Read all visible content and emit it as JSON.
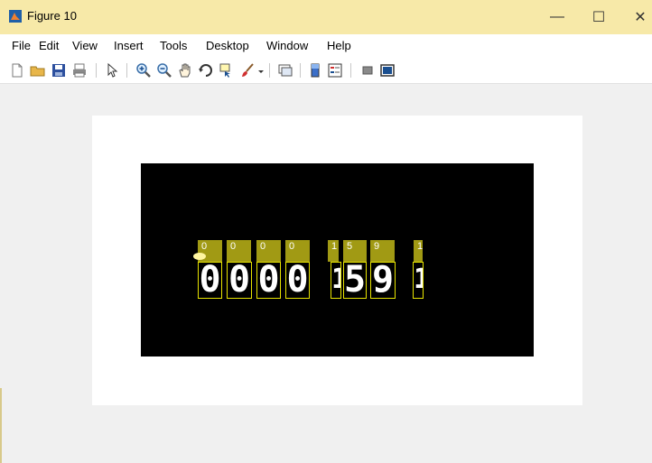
{
  "window": {
    "title": "Figure 10",
    "minimize_symbol": "—",
    "maximize_symbol": "☐",
    "close_symbol": "✕"
  },
  "menu": [
    {
      "label": "File"
    },
    {
      "label": "Edit"
    },
    {
      "label": "View"
    },
    {
      "label": "Insert"
    },
    {
      "label": "Tools"
    },
    {
      "label": "Desktop"
    },
    {
      "label": "Window"
    },
    {
      "label": "Help"
    }
  ],
  "toolbar": [
    {
      "icon": "new-figure-icon"
    },
    {
      "icon": "open-file-icon"
    },
    {
      "icon": "save-icon"
    },
    {
      "icon": "print-icon"
    },
    {
      "icon": "edit-plot-icon"
    },
    {
      "icon": "zoom-in-icon"
    },
    {
      "icon": "zoom-out-icon"
    },
    {
      "icon": "pan-icon"
    },
    {
      "icon": "rotate-3d-icon"
    },
    {
      "icon": "data-cursor-icon"
    },
    {
      "icon": "brush-icon"
    },
    {
      "icon": "link-plot-icon"
    },
    {
      "icon": "insert-colorbar-icon"
    },
    {
      "icon": "insert-legend-icon"
    },
    {
      "icon": "hide-plot-tools-icon"
    },
    {
      "icon": "show-plot-tools-icon"
    }
  ],
  "figure": {
    "detections": [
      {
        "label": "0",
        "digit": "0"
      },
      {
        "label": "0",
        "digit": "0"
      },
      {
        "label": "0",
        "digit": "0"
      },
      {
        "label": "0",
        "digit": "0"
      },
      {
        "label": "1",
        "digit": "1"
      },
      {
        "label": "5",
        "digit": "5"
      },
      {
        "label": "9",
        "digit": "9"
      },
      {
        "label": "1",
        "digit": "1"
      }
    ]
  },
  "colors": {
    "titlebar": "#f7e9a8",
    "figure_background": "#f0f0f0",
    "image_background": "#000000",
    "label_fill": "#a19a14",
    "box_outline": "#e8e400"
  }
}
